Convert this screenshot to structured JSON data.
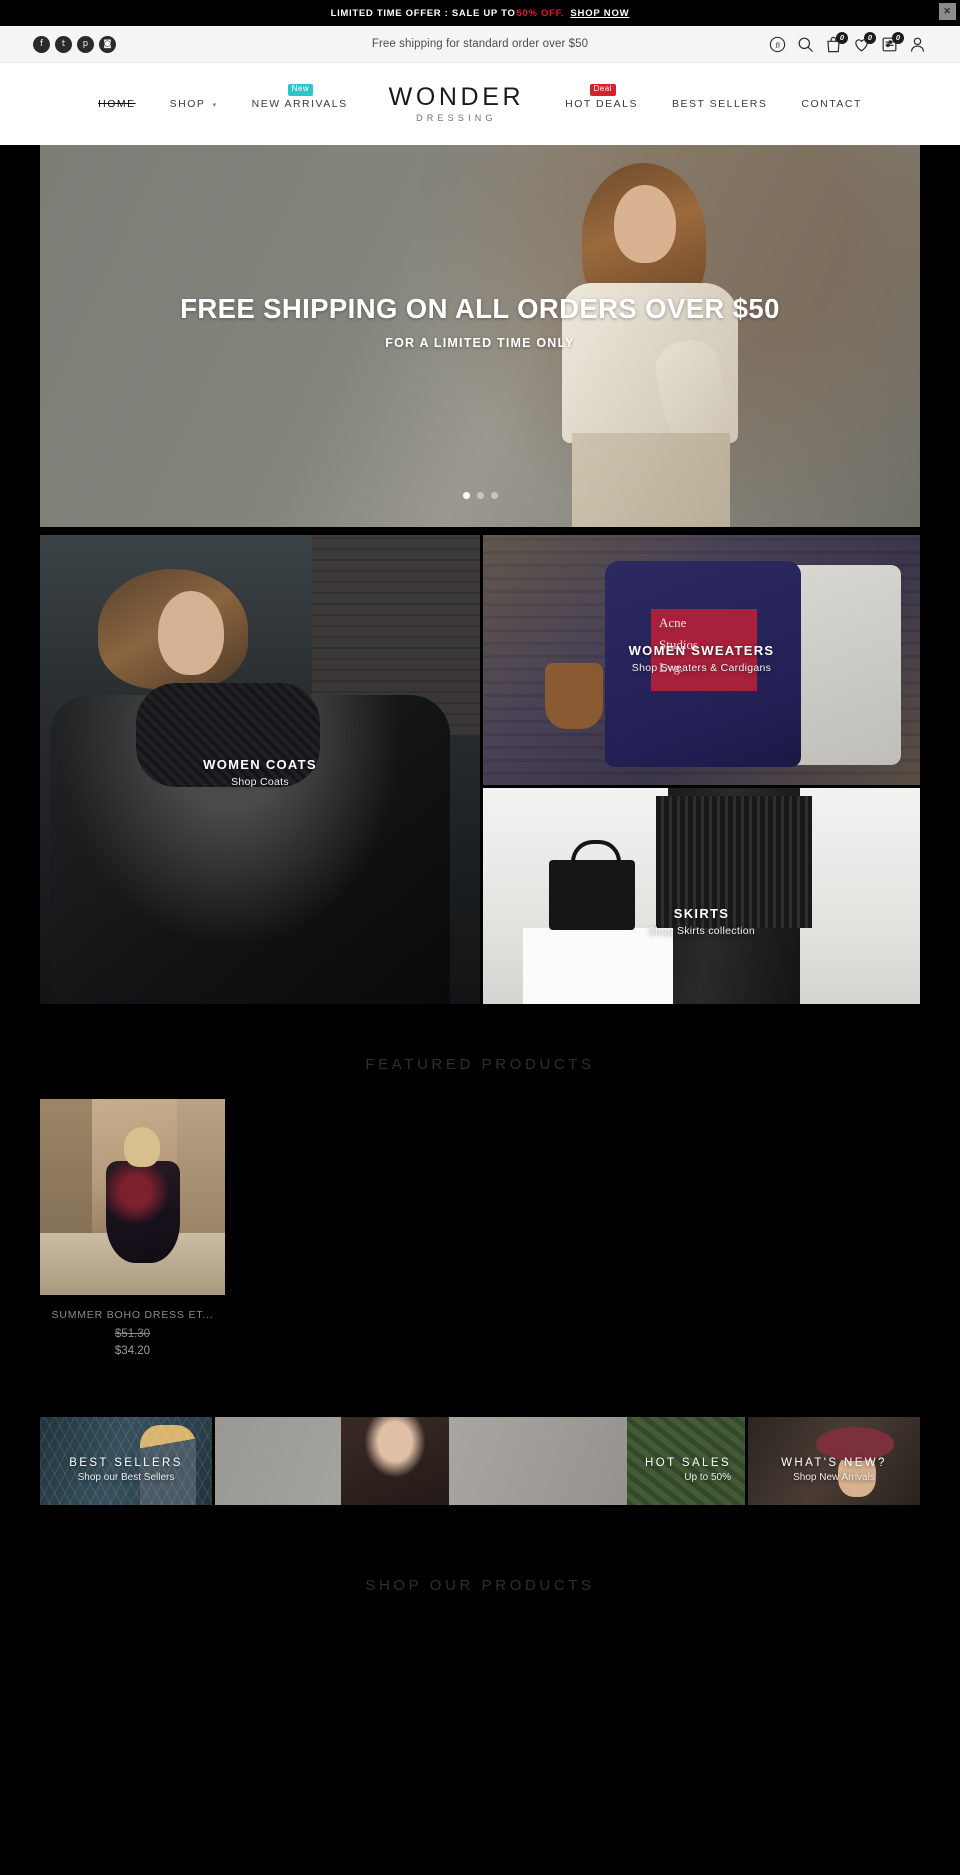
{
  "promo_bar": {
    "text_before": "LIMITED TIME OFFER : SALE UP TO",
    "percent": "50% OFF.",
    "cta": "SHOP NOW",
    "close_label": "✕"
  },
  "utility_bar": {
    "shipping_note": "Free shipping for standard order over $50",
    "social": [
      {
        "name": "facebook-icon",
        "glyph": "f"
      },
      {
        "name": "twitter-icon",
        "glyph": "t"
      },
      {
        "name": "pinterest-icon",
        "glyph": "p"
      },
      {
        "name": "instagram-icon",
        "glyph": "◙"
      }
    ],
    "icons": [
      {
        "name": "currency-icon",
        "label": "B",
        "badge": null
      },
      {
        "name": "search-icon",
        "label": "",
        "badge": null
      },
      {
        "name": "cart-icon",
        "label": "",
        "badge": "0"
      },
      {
        "name": "wishlist-icon",
        "label": "",
        "badge": "0"
      },
      {
        "name": "compare-icon",
        "label": "",
        "badge": "0"
      },
      {
        "name": "account-icon",
        "label": "",
        "badge": null
      }
    ]
  },
  "nav": {
    "left_items": [
      {
        "label": "HOME",
        "active": true,
        "caret": false,
        "badge": null
      },
      {
        "label": "SHOP",
        "active": false,
        "caret": true,
        "badge": null
      },
      {
        "label": "NEW ARRIVALS",
        "active": false,
        "caret": false,
        "badge": "New",
        "badge_kind": "new"
      }
    ],
    "right_items": [
      {
        "label": "HOT DEALS",
        "active": false,
        "caret": false,
        "badge": "Deal",
        "badge_kind": "deal"
      },
      {
        "label": "BEST SELLERS",
        "active": false,
        "caret": false,
        "badge": null
      },
      {
        "label": "CONTACT",
        "active": false,
        "caret": false,
        "badge": null
      }
    ],
    "brand_main": "WONDER",
    "brand_sub": "DRESSING"
  },
  "hero": {
    "headline": "FREE SHIPPING ON ALL ORDERS OVER $50",
    "subheadline": "FOR A LIMITED TIME ONLY",
    "slide_count": 3,
    "active_slide": 1
  },
  "categories": [
    {
      "title": "WOMEN COATS",
      "subtitle": "Shop Coats"
    },
    {
      "title": "WOMEN SWEATERS",
      "subtitle": "Shop Sweaters & Cardigans"
    },
    {
      "title": "SKIRTS",
      "subtitle": "Shop Skirts collection"
    }
  ],
  "sweater_graphic": {
    "line1": "Acne",
    "line2": "Studios",
    "line3": "Lvg."
  },
  "featured": {
    "heading": "FEATURED PRODUCTS",
    "products": [
      {
        "name": "SUMMER BOHO DRESS ET...",
        "price_old": "$51.30",
        "price_new": "$34.20"
      }
    ]
  },
  "promo_tiles": [
    {
      "title": "BEST SELLERS",
      "subtitle": "Shop our Best Sellers"
    },
    {
      "title": "HOT SALES",
      "subtitle": "Up to 50%"
    },
    {
      "title": "WHAT'S NEW?",
      "subtitle": "Shop New Arrivals"
    }
  ],
  "bottom": {
    "heading": "SHOP OUR PRODUCTS"
  },
  "colors": {
    "accent_red": "#d9202a",
    "badge_new": "#2ec4c9",
    "badge_deal": "#d9202a",
    "page_bg": "#000000",
    "util_bg": "#f5f5f5"
  }
}
